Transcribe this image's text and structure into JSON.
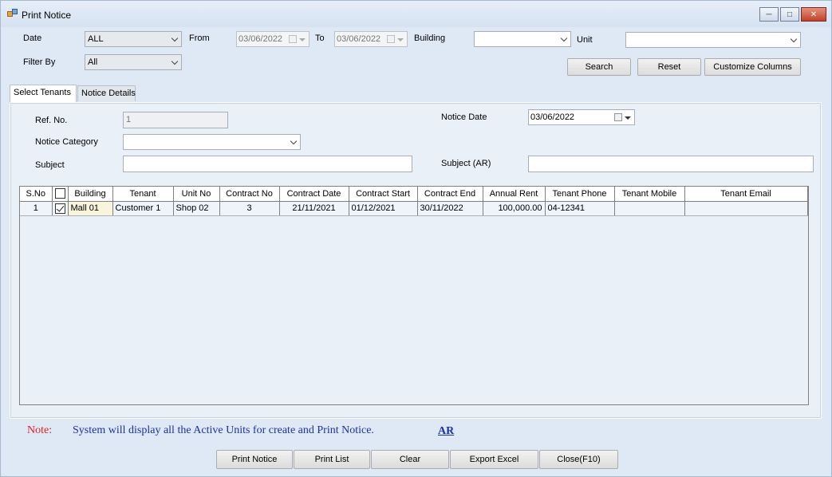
{
  "window": {
    "title": "Print Notice"
  },
  "filters": {
    "date_label": "Date",
    "date_value": "ALL",
    "from_label": "From",
    "from_value": "03/06/2022",
    "to_label": "To",
    "to_value": "03/06/2022",
    "building_label": "Building",
    "building_value": "",
    "unit_label": "Unit",
    "unit_value": "",
    "filterby_label": "Filter By",
    "filterby_value": "All"
  },
  "actions": {
    "search": "Search",
    "reset": "Reset",
    "customize": "Customize Columns"
  },
  "tabs": [
    {
      "label": "Select Tenants",
      "active": true
    },
    {
      "label": "Notice Details",
      "active": false
    }
  ],
  "form": {
    "ref_label": "Ref. No.",
    "ref_value": "1",
    "notice_date_label": "Notice Date",
    "notice_date_value": "03/06/2022",
    "category_label": "Notice Category",
    "category_value": "",
    "subject_label": "Subject",
    "subject_value": "",
    "subject_ar_label": "Subject (AR)",
    "subject_ar_value": ""
  },
  "grid": {
    "columns": [
      "S.No",
      "",
      "Building",
      "Tenant",
      "Unit No",
      "Contract No",
      "Contract Date",
      "Contract Start",
      "Contract End",
      "Annual Rent",
      "Tenant Phone",
      "Tenant Mobile",
      "Tenant Email"
    ],
    "rows": [
      {
        "sno": "1",
        "checked": true,
        "building": "Mall 01",
        "tenant": "Customer 1",
        "unit": "Shop 02",
        "contract_no": "3",
        "contract_date": "21/11/2021",
        "contract_start": "01/12/2021",
        "contract_end": "30/11/2022",
        "annual_rent": "100,000.00",
        "phone": "04-12341",
        "mobile": "",
        "email": ""
      }
    ]
  },
  "note": {
    "label": "Note:",
    "text": "System will display all the Active Units for create and Print Notice.",
    "link": "AR"
  },
  "bottom_buttons": {
    "print_notice": "Print Notice",
    "print_list": "Print List",
    "clear": "Clear",
    "export_excel": "Export Excel",
    "close": "Close(F10)"
  }
}
